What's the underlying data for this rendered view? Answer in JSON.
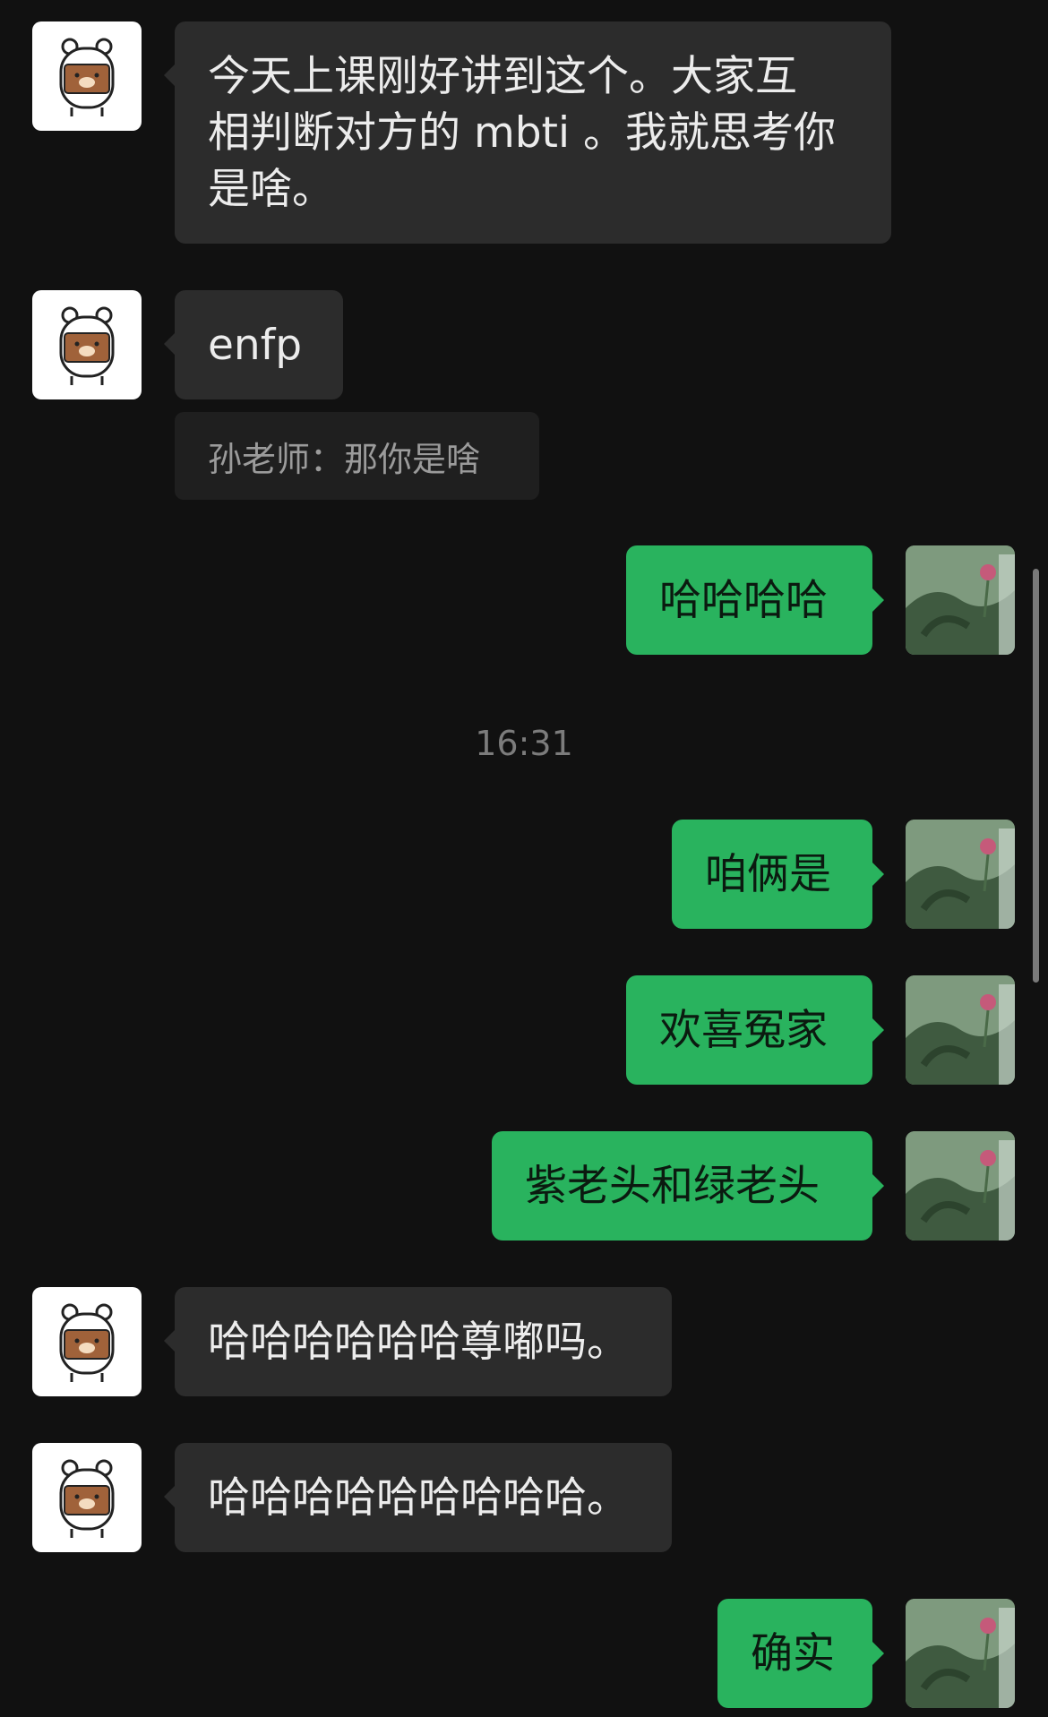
{
  "chat": {
    "messages": [
      {
        "side": "in",
        "text": "今天上课刚好讲到这个。大家互\n相判断对方的 mbti 。我就思考你\n是啥。"
      },
      {
        "side": "in",
        "text": "enfp",
        "quote": "孙老师：那你是啥"
      },
      {
        "side": "out",
        "text": "哈哈哈哈"
      },
      {
        "side": "out",
        "text": "咱俩是"
      },
      {
        "side": "out",
        "text": "欢喜冤家"
      },
      {
        "side": "out",
        "text": "紫老头和绿老头"
      },
      {
        "side": "in",
        "text": "哈哈哈哈哈哈尊嘟吗。"
      },
      {
        "side": "in",
        "text": "哈哈哈哈哈哈哈哈哈。"
      },
      {
        "side": "out",
        "text": "确实"
      }
    ],
    "timestamp": "16:31"
  },
  "icons": {
    "contact_avatar": "bear-avatar-icon",
    "self_avatar": "flower-photo-avatar"
  },
  "colors": {
    "background": "#111111",
    "incoming_bubble": "#2c2c2c",
    "outgoing_bubble": "#29b35e"
  }
}
